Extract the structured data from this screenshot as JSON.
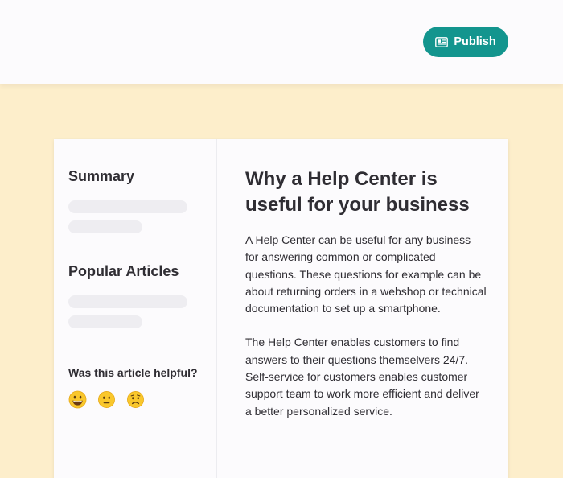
{
  "header": {
    "publish_label": "Publish",
    "publish_icon": "newspaper-icon",
    "accent": "#13958e"
  },
  "sidebar": {
    "summary_heading": "Summary",
    "popular_heading": "Popular Articles",
    "helpful_question": "Was this article helpful?",
    "reactions": [
      "grinning-face-icon",
      "neutral-face-icon",
      "frowning-face-icon"
    ]
  },
  "article": {
    "title": "Why a Help Center is useful for your business",
    "paragraphs": [
      "A Help Center can be useful for any business for answering common or complicated questions. These questions for example can be about returning orders in a webshop or technical documentation to set up a smartphone.",
      "The Help Center enables customers to find answers to their questions themselvers 24/7. Self-service for customers enables customer support team to work more efficient and deliver a better personalized service."
    ]
  },
  "colors": {
    "background": "#fdeecb",
    "card": "#fcfbfd",
    "skeleton": "#eeedf1",
    "text": "#2f2d33"
  }
}
